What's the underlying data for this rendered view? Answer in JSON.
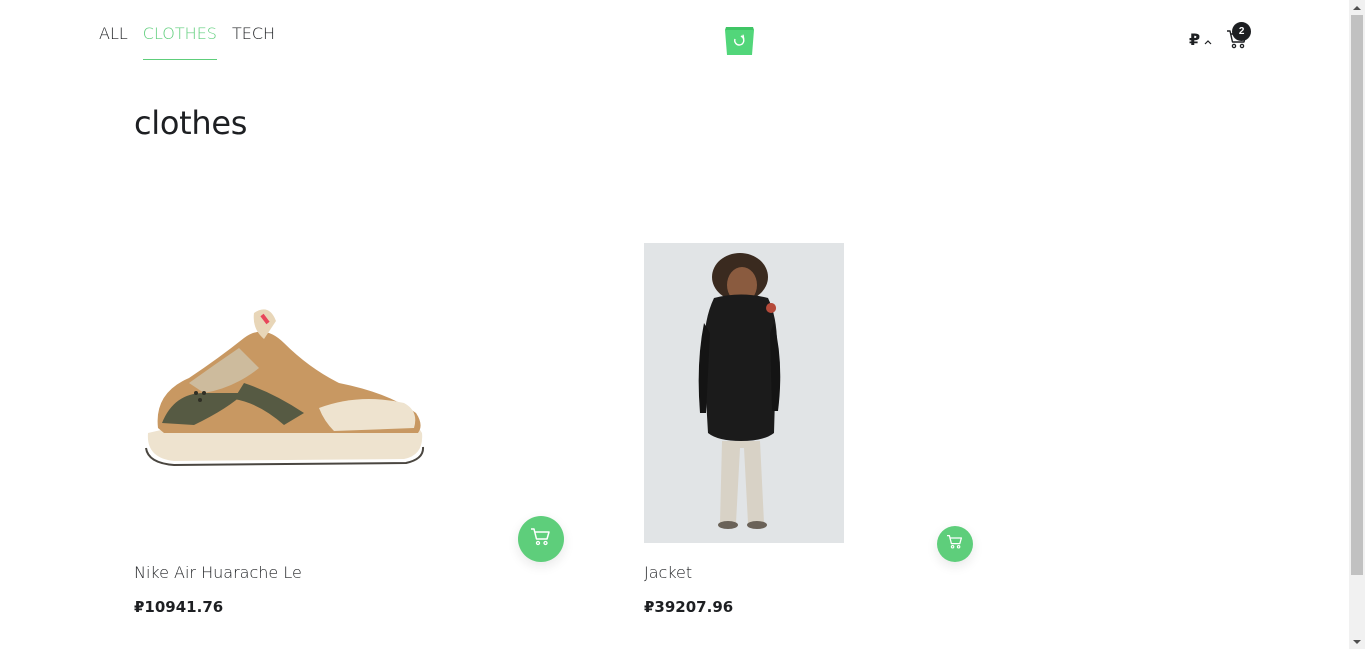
{
  "nav": {
    "items": [
      {
        "label": "ALL",
        "active": false
      },
      {
        "label": "CLOTHES",
        "active": true
      },
      {
        "label": "TECH",
        "active": false
      }
    ]
  },
  "header": {
    "logo_icon": "shopping-bag-logo-icon",
    "currency_symbol": "₽",
    "cart_count": "2"
  },
  "category": {
    "title": "clothes"
  },
  "products": [
    {
      "name": "Nike Air Huarache Le",
      "price": "₽10941.76",
      "image": "sneaker-image",
      "add_icon": "cart-icon"
    },
    {
      "name": "Jacket",
      "price": "₽39207.96",
      "image": "jacket-model-image",
      "add_icon": "cart-icon"
    }
  ],
  "colors": {
    "accent": "#5ece7b",
    "text": "#1d1f22",
    "background": "#ffffff"
  }
}
